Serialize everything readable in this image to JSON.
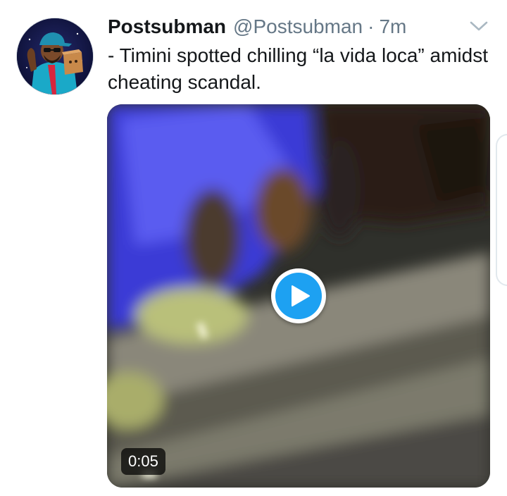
{
  "tweet": {
    "display_name": "Postsubman",
    "handle": "@Postsubman",
    "separator": "·",
    "time": "7m",
    "text": "- Timini spotted chilling “la vida loca” amidst cheating scandal.",
    "media": {
      "duration": "0:05",
      "play_color": "#1da1f2"
    }
  },
  "colors": {
    "text_primary": "#14171a",
    "text_secondary": "#657786",
    "accent": "#1da1f2"
  },
  "icons": {
    "avatar": "cartoon-avatar",
    "more": "chevron-down-icon",
    "play": "play-icon"
  }
}
